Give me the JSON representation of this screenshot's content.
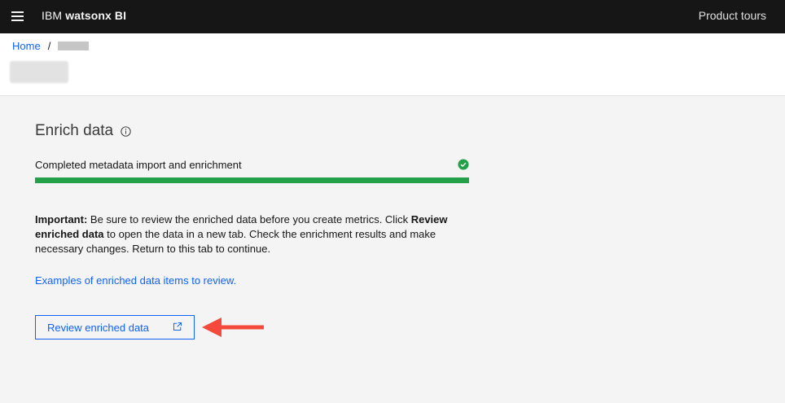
{
  "topbar": {
    "brand_prefix": "IBM",
    "brand_name": "watsonx BI",
    "product_tours": "Product tours"
  },
  "breadcrumb": {
    "home": "Home",
    "separator": "/"
  },
  "main": {
    "section_title": "Enrich data",
    "progress": {
      "label": "Completed metadata import and enrichment",
      "percent": 100,
      "status": "complete"
    },
    "important": {
      "lead": "Important:",
      "text1": " Be sure to review the enriched data before you create metrics. Click ",
      "bold_action": "Review enriched data",
      "text2": " to open the data in a new tab. Check the enrichment results and make necessary changes. Return to this tab to continue."
    },
    "examples_link": "Examples of enriched data items to review.",
    "review_button": "Review enriched data"
  },
  "colors": {
    "topbar_bg": "#161616",
    "link_blue": "#0f62fe",
    "success_green": "#24a148",
    "annotation_red": "#f4493b"
  },
  "icons": [
    "menu-icon",
    "info-icon",
    "check-icon",
    "launch-icon"
  ]
}
